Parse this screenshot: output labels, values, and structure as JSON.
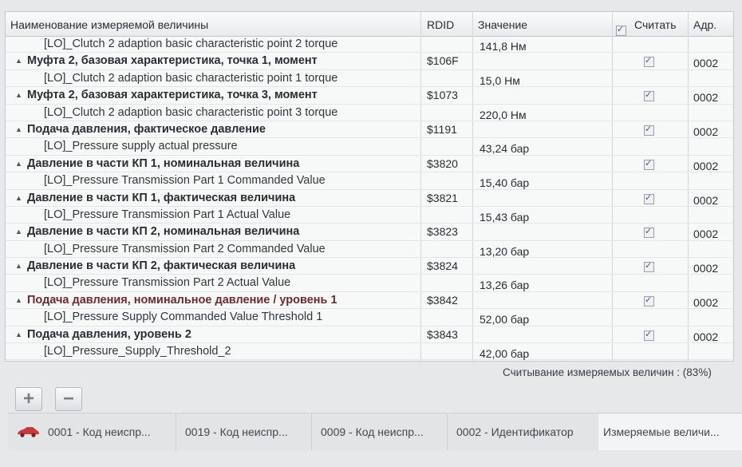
{
  "table": {
    "headers": {
      "name": "Наименование измеряемой величины",
      "rdid": "RDID",
      "value": "Значение",
      "read": "Считать",
      "addr": "Адр."
    },
    "rows": [
      {
        "type": "sub",
        "label": "[LO]_Clutch 2 adaption basic characteristic point 2 torque",
        "rdid": "",
        "value": "141,8 Нм",
        "checked": false,
        "addr": ""
      },
      {
        "type": "group",
        "label": "Муфта 2, базовая характеристика, точка 1, момент",
        "rdid": "$106F",
        "value": "",
        "checked": true,
        "addr": "0002"
      },
      {
        "type": "sub",
        "label": "[LO]_Clutch 2 adaption basic characteristic point 1 torque",
        "rdid": "",
        "value": "15,0 Нм",
        "checked": false,
        "addr": ""
      },
      {
        "type": "group",
        "label": "Муфта 2, базовая характеристика, точка 3, момент",
        "rdid": "$1073",
        "value": "",
        "checked": true,
        "addr": "0002"
      },
      {
        "type": "sub",
        "label": "[LO]_Clutch 2 adaption basic characteristic point 3 torque",
        "rdid": "",
        "value": "220,0 Нм",
        "checked": false,
        "addr": ""
      },
      {
        "type": "group",
        "label": "Подача давления, фактическое давление",
        "rdid": "$1191",
        "value": "",
        "checked": true,
        "addr": "0002"
      },
      {
        "type": "sub",
        "label": "[LO]_Pressure supply actual pressure",
        "rdid": "",
        "value": "43,24 бар",
        "checked": false,
        "addr": ""
      },
      {
        "type": "group",
        "label": "Давление в части КП 1, номинальная величина",
        "rdid": "$3820",
        "value": "",
        "checked": true,
        "addr": "0002"
      },
      {
        "type": "sub",
        "label": "[LO]_Pressure Transmission Part 1 Commanded Value",
        "rdid": "",
        "value": "15,40 бар",
        "checked": false,
        "addr": ""
      },
      {
        "type": "group",
        "label": "Давление в части КП 1, фактическая величина",
        "rdid": "$3821",
        "value": "",
        "checked": true,
        "addr": "0002"
      },
      {
        "type": "sub",
        "label": "[LO]_Pressure Transmission Part 1 Actual Value",
        "rdid": "",
        "value": "15,43 бар",
        "checked": false,
        "addr": ""
      },
      {
        "type": "group",
        "label": "Давление в части КП 2, номинальная величина",
        "rdid": "$3823",
        "value": "",
        "checked": true,
        "addr": "0002"
      },
      {
        "type": "sub",
        "label": "[LO]_Pressure Transmission Part 2 Commanded Value",
        "rdid": "",
        "value": "13,20 бар",
        "checked": false,
        "addr": ""
      },
      {
        "type": "group",
        "label": "Давление в части КП 2, фактическая величина",
        "rdid": "$3824",
        "value": "",
        "checked": true,
        "addr": "0002"
      },
      {
        "type": "sub",
        "label": "[LO]_Pressure Transmission Part 2 Actual Value",
        "rdid": "",
        "value": "13,26 бар",
        "checked": false,
        "addr": ""
      },
      {
        "type": "group",
        "label": "Подача давления, номинальное давление / уровень 1",
        "rdid": "$3842",
        "value": "",
        "checked": true,
        "addr": "0002",
        "highlight": true
      },
      {
        "type": "sub",
        "label": "[LO]_Pressure Supply Commanded Value Threshold 1",
        "rdid": "",
        "value": "52,00 бар",
        "checked": false,
        "addr": ""
      },
      {
        "type": "group",
        "label": "Подача давления, уровень 2",
        "rdid": "$3843",
        "value": "",
        "checked": true,
        "addr": "0002"
      },
      {
        "type": "sub",
        "label": "[LO]_Pressure_Supply_Threshold_2",
        "rdid": "",
        "value": "42,00 бар",
        "checked": false,
        "addr": ""
      }
    ]
  },
  "status": {
    "text": "Считывание измеряемых величин : (83%)",
    "progress_percent": 83
  },
  "buttons": {
    "add": "+",
    "remove": "−"
  },
  "tabs": [
    {
      "label": "0001 - Код неиспр..."
    },
    {
      "label": "0019 - Код неиспр..."
    },
    {
      "label": "0009 - Код неиспр..."
    },
    {
      "label": "0002 - Идентификатор"
    },
    {
      "label": "Измеряемые величи..."
    }
  ],
  "icons": {
    "car": "car-icon",
    "checkbox": "checkbox-icon"
  },
  "colors": {
    "highlight_text": "#6b2a2e",
    "check": "#3b5d8a"
  }
}
